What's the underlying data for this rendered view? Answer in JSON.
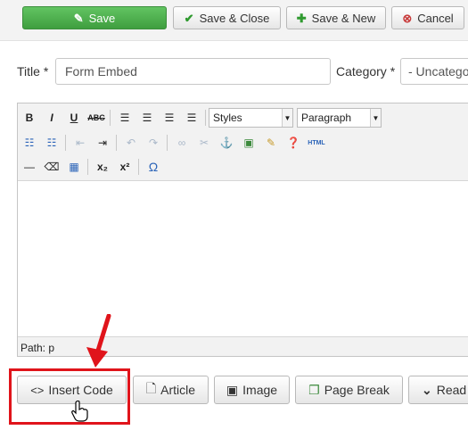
{
  "toolbar": {
    "save": "Save",
    "save_close": "Save & Close",
    "save_new": "Save & New",
    "cancel": "Cancel"
  },
  "form": {
    "title_label": "Title *",
    "title_value": "Form Embed",
    "category_label": "Category *",
    "category_value": "- Uncatego"
  },
  "editor": {
    "styles_select": "Styles",
    "format_select": "Paragraph",
    "html_button": "HTML",
    "path": "Path: p"
  },
  "bottom_buttons": {
    "insert_code": "Insert Code",
    "article": "Article",
    "image": "Image",
    "page_break": "Page Break",
    "read_more": "Read"
  },
  "colors": {
    "save_green": "#4cae4c",
    "highlight_red": "#e0141b"
  }
}
